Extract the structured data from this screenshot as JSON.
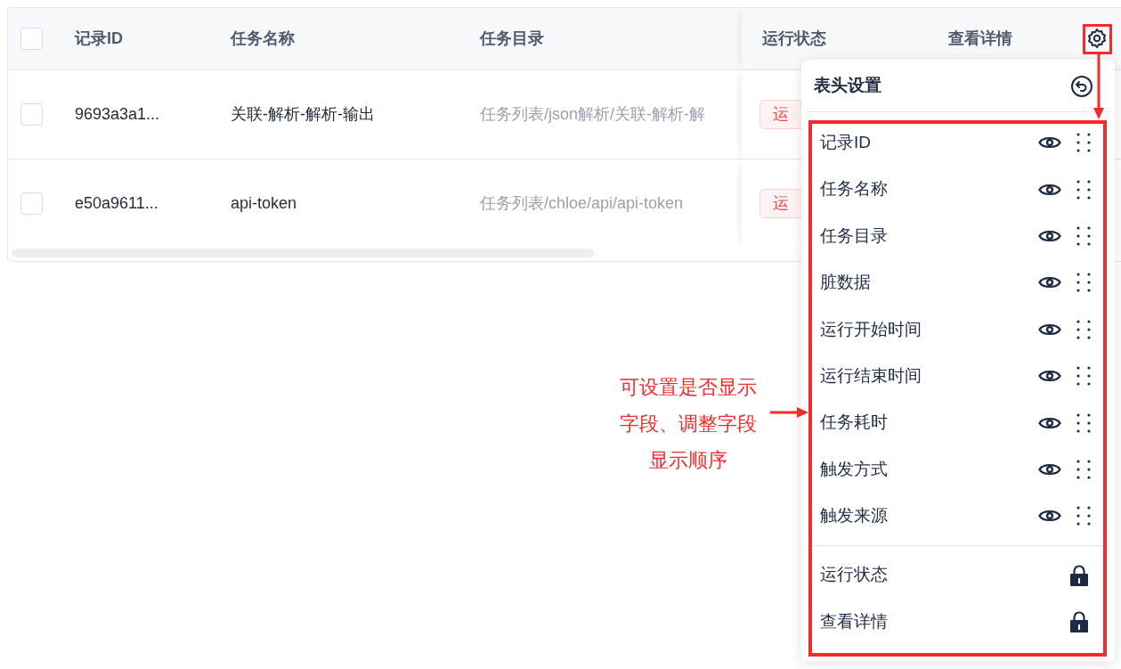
{
  "table": {
    "columns": [
      {
        "label": "记录ID"
      },
      {
        "label": "任务名称"
      },
      {
        "label": "任务目录"
      },
      {
        "label": "运行状态"
      },
      {
        "label": "查看详情"
      }
    ],
    "header_checked": false,
    "rows": [
      {
        "checked": false,
        "id": "9693a3a1...",
        "name": "关联-解析-解析-输出",
        "directory": "任务列表/json解析/关联-解析-解",
        "status": "运"
      },
      {
        "checked": false,
        "id": "e50a9611...",
        "name": "api-token",
        "directory": "任务列表/chloe/api/api-token",
        "status": "运"
      }
    ]
  },
  "column_settings": {
    "title": "表头设置",
    "items": [
      {
        "kind": "toggle",
        "label": "记录ID",
        "visible": true
      },
      {
        "kind": "toggle",
        "label": "任务名称",
        "visible": true
      },
      {
        "kind": "toggle",
        "label": "任务目录",
        "visible": true
      },
      {
        "kind": "toggle",
        "label": "脏数据",
        "visible": true
      },
      {
        "kind": "toggle",
        "label": "运行开始时间",
        "visible": true
      },
      {
        "kind": "toggle",
        "label": "运行结束时间",
        "visible": true
      },
      {
        "kind": "toggle",
        "label": "任务耗时",
        "visible": true
      },
      {
        "kind": "toggle",
        "label": "触发方式",
        "visible": true
      },
      {
        "kind": "toggle",
        "label": "触发来源",
        "visible": true
      },
      {
        "kind": "locked",
        "label": "运行状态"
      },
      {
        "kind": "locked",
        "label": "查看详情"
      }
    ]
  },
  "annotation": {
    "lines": [
      "可设置是否显示",
      "字段、调整字段",
      "显示顺序"
    ]
  }
}
